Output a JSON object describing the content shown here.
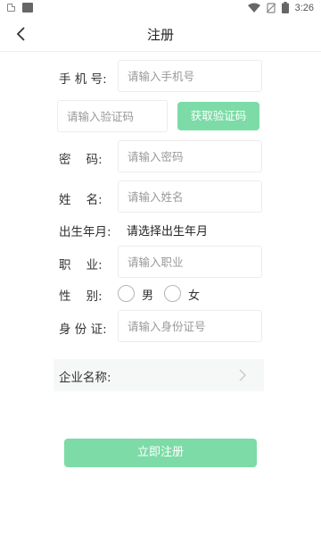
{
  "status_bar": {
    "time": "3:26",
    "icons": [
      "sim-icon",
      "sd-card-icon",
      "wifi-icon",
      "no-sim-icon",
      "battery-icon"
    ]
  },
  "header": {
    "title": "注册",
    "back_icon": "chevron-left-icon"
  },
  "form": {
    "phone": {
      "label": "手 机 号:",
      "placeholder": "请输入手机号"
    },
    "code": {
      "placeholder": "请输入验证码",
      "button": "获取验证码"
    },
    "password": {
      "label": "密    码:",
      "placeholder": "请输入密码"
    },
    "name": {
      "label": "姓    名:",
      "placeholder": "请输入姓名"
    },
    "birth": {
      "label": "出生年月:",
      "value": "请选择出生年月"
    },
    "job": {
      "label": "职    业:",
      "placeholder": "请输入职业"
    },
    "gender": {
      "label": "性    别:",
      "options": [
        "男",
        "女"
      ]
    },
    "id_card": {
      "label": "身 份 证:",
      "placeholder": "请输入身份证号"
    },
    "company": {
      "label": "企业名称:",
      "icon": "chevron-right-icon"
    }
  },
  "submit_label": "立即注册",
  "colors": {
    "accent": "#7ddba7",
    "border": "#ececec",
    "placeholder": "#999999"
  }
}
